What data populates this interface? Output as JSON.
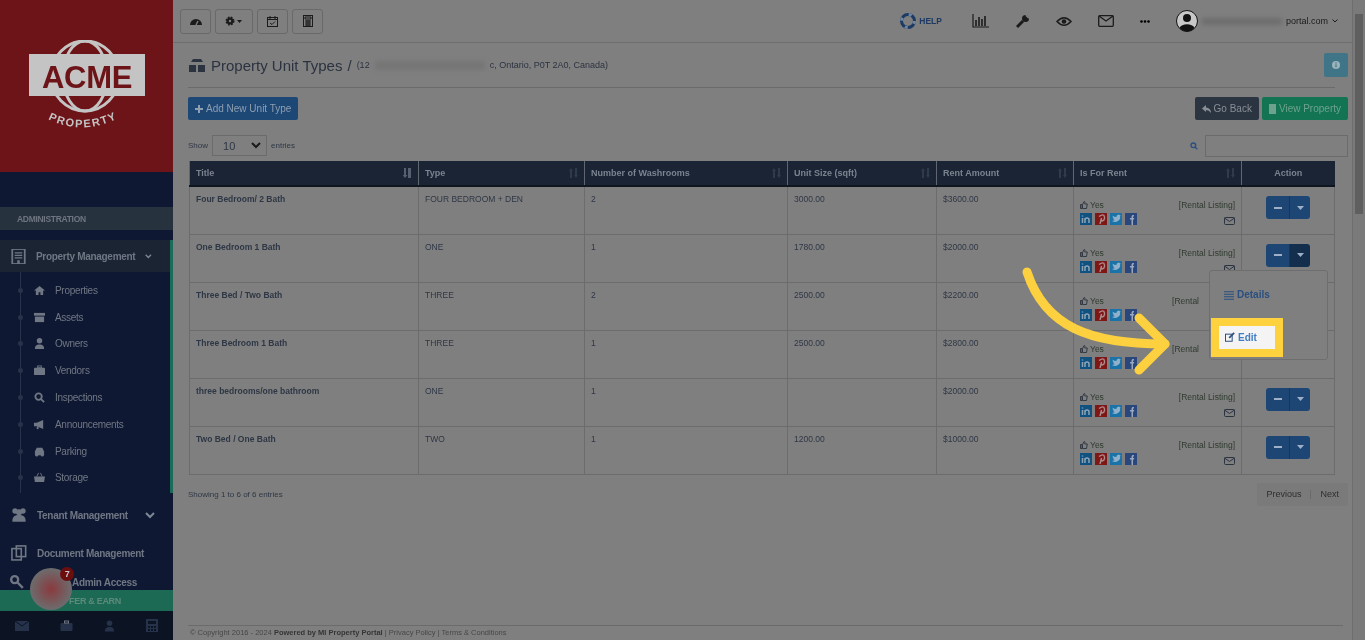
{
  "sidebar": {
    "logo": {
      "word": "ACME",
      "sub": "PROPERTY"
    },
    "section": "ADMINISTRATION",
    "groups": [
      {
        "label": "Property Management",
        "expanded": true,
        "children": [
          {
            "label": "Properties"
          },
          {
            "label": "Assets"
          },
          {
            "label": "Owners"
          },
          {
            "label": "Vendors"
          },
          {
            "label": "Inspections"
          },
          {
            "label": "Announcements"
          },
          {
            "label": "Parking"
          },
          {
            "label": "Storage"
          }
        ]
      },
      {
        "label": "Tenant Management",
        "expanded": false
      },
      {
        "label": "Document Management"
      }
    ],
    "admin": "Admin Access",
    "refer": "FER & EARN",
    "badge": "7"
  },
  "topbar": {
    "help": "HELP",
    "user": "portal.com"
  },
  "header": {
    "title": "Property Unit Types",
    "separator": "/",
    "address_start": "(12",
    "address_end": "c, Ontario, P0T 2A0, Canada)"
  },
  "buttons": {
    "add": "Add New Unit Type",
    "back": "Go Back",
    "view": "View Property"
  },
  "length": {
    "before": "Show",
    "value": "10",
    "after": "entries"
  },
  "table": {
    "columns": [
      {
        "label": "Title",
        "sorted": true
      },
      {
        "label": "Type",
        "sorted": false
      },
      {
        "label": "Number of Washrooms",
        "sorted": false
      },
      {
        "label": "Unit Size (sqft)",
        "sorted": false
      },
      {
        "label": "Rent Amount",
        "sorted": false
      },
      {
        "label": "Is For Rent",
        "sorted": false
      },
      {
        "label": "Action"
      }
    ],
    "rows": [
      {
        "title": "Four Bedroom/ 2 Bath",
        "type": "FOUR BEDROOM + DEN",
        "washrooms": "2",
        "size": "3000.00",
        "rent": "$3600.00",
        "for_rent": "Yes",
        "listing": "[Rental Listing]",
        "menu_open": false,
        "covered": false
      },
      {
        "title": "One Bedroom 1 Bath",
        "type": "ONE",
        "washrooms": "1",
        "size": "1780.00",
        "rent": "$2000.00",
        "for_rent": "Yes",
        "listing": "[Rental Listing]",
        "menu_open": true,
        "covered": false
      },
      {
        "title": "Three Bed / Two Bath",
        "type": "THREE",
        "washrooms": "2",
        "size": "2500.00",
        "rent": "$2200.00",
        "for_rent": "Yes",
        "listing": "[Rental",
        "menu_open": false,
        "covered": true
      },
      {
        "title": "Three Bedroom 1 Bath",
        "type": "THREE",
        "washrooms": "1",
        "size": "2500.00",
        "rent": "$2800.00",
        "for_rent": "Yes",
        "listing": "[Rental",
        "menu_open": false,
        "covered": true
      },
      {
        "title": "three bedrooms/one bathroom",
        "type": "ONE",
        "washrooms": "1",
        "rent": "$2000.00",
        "for_rent": "Yes",
        "listing": "[Rental Listing]",
        "menu_open": false,
        "covered": false
      },
      {
        "title": "Two Bed / One Bath",
        "type": "TWO",
        "washrooms": "1",
        "size": "1200.00",
        "rent": "$1000.00",
        "for_rent": "Yes",
        "listing": "[Rental Listing]",
        "menu_open": false,
        "covered": false
      }
    ]
  },
  "menu": {
    "items": [
      {
        "label": "Details",
        "highlighted": false
      },
      {
        "label": "Edit",
        "highlighted": true
      }
    ]
  },
  "info": "Showing 1 to 6 of 6 entries",
  "pagination": {
    "previous": "Previous",
    "next": "Next",
    "disabled": true
  },
  "footer": "© Copyright 2016 - 2024 **Powered by MI Property Portal** | Privacy Policy | Terms & Conditions"
}
